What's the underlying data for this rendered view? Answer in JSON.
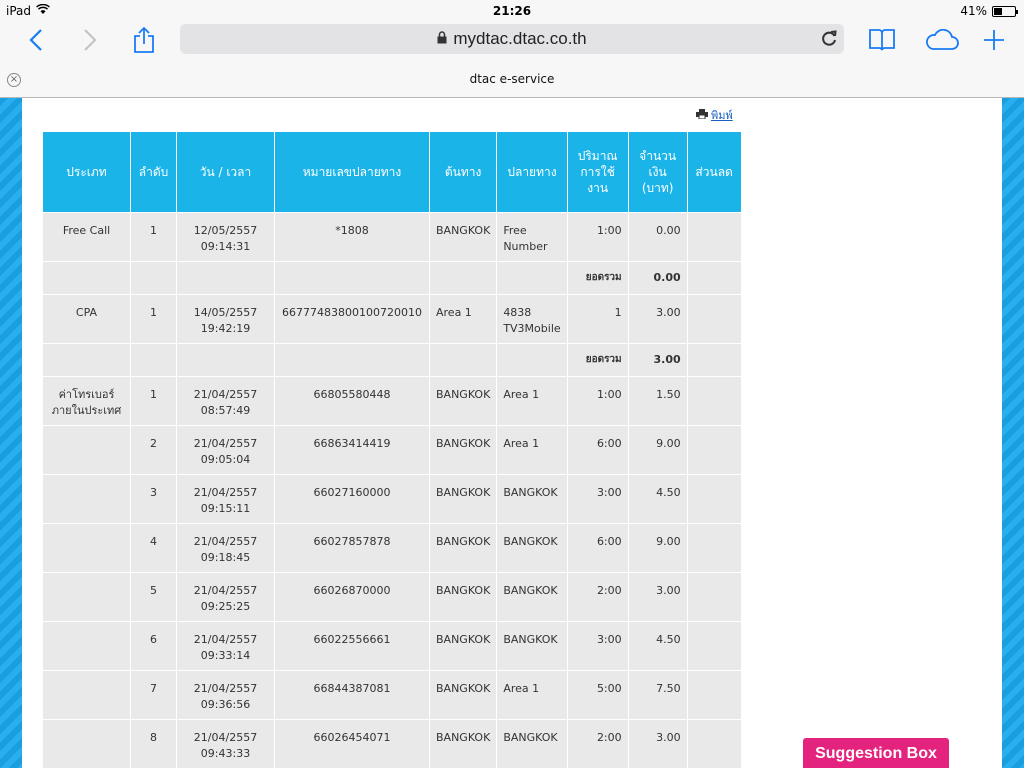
{
  "status": {
    "device": "iPad",
    "time": "21:26",
    "battery": "41%",
    "battery_level": 0.41
  },
  "browser": {
    "url": "mydtac.dtac.co.th",
    "tab_title": "dtac e-service",
    "icons": {
      "back": "chevron-left-icon",
      "forward": "chevron-right-icon",
      "share": "share-icon",
      "bookmarks": "book-icon",
      "cloud": "cloud-icon",
      "new_tab": "plus-icon",
      "reload": "reload-icon",
      "lock": "lock-icon"
    }
  },
  "colors": {
    "header_bg": "#1bb4e8",
    "stripe": "#1a9ee0",
    "cell_bg": "#e9e9e9",
    "suggestion": "#e3237d"
  },
  "page": {
    "print_label": "พิมพ์",
    "suggestion_label": "Suggestion Box"
  },
  "table": {
    "headers": [
      "ประเภท",
      "ลำดับ",
      "วัน / เวลา",
      "หมายเลขปลายทาง",
      "ต้นทาง",
      "ปลายทาง",
      "ปริมาณ การใช้ งาน",
      "จำนวน เงิน (บาท)",
      "ส่วนลด"
    ],
    "rows": [
      {
        "kind": "data",
        "cells": [
          "Free Call",
          "1",
          "12/05/2557 09:14:31",
          "*1808",
          "BANGKOK",
          "Free Number",
          "1:00",
          "0.00",
          ""
        ]
      },
      {
        "kind": "total",
        "label": "ยอดรวม",
        "value": "0.00"
      },
      {
        "kind": "data",
        "cells": [
          "CPA",
          "1",
          "14/05/2557 19:42:19",
          "66777483800100720010",
          "Area 1",
          "4838 TV3Mobile",
          "1",
          "3.00",
          ""
        ]
      },
      {
        "kind": "total",
        "label": "ยอดรวม",
        "value": "3.00"
      },
      {
        "kind": "data",
        "cells": [
          "ค่าโทรเบอร์ ภายในประเทศ",
          "1",
          "21/04/2557 08:57:49",
          "66805580448",
          "BANGKOK",
          "Area 1",
          "1:00",
          "1.50",
          ""
        ]
      },
      {
        "kind": "data",
        "cells": [
          "",
          "2",
          "21/04/2557 09:05:04",
          "66863414419",
          "BANGKOK",
          "Area 1",
          "6:00",
          "9.00",
          ""
        ]
      },
      {
        "kind": "data",
        "cells": [
          "",
          "3",
          "21/04/2557 09:15:11",
          "66027160000",
          "BANGKOK",
          "BANGKOK",
          "3:00",
          "4.50",
          ""
        ]
      },
      {
        "kind": "data",
        "cells": [
          "",
          "4",
          "21/04/2557 09:18:45",
          "66027857878",
          "BANGKOK",
          "BANGKOK",
          "6:00",
          "9.00",
          ""
        ]
      },
      {
        "kind": "data",
        "cells": [
          "",
          "5",
          "21/04/2557 09:25:25",
          "66026870000",
          "BANGKOK",
          "BANGKOK",
          "2:00",
          "3.00",
          ""
        ]
      },
      {
        "kind": "data",
        "cells": [
          "",
          "6",
          "21/04/2557 09:33:14",
          "66022556661",
          "BANGKOK",
          "BANGKOK",
          "3:00",
          "4.50",
          ""
        ]
      },
      {
        "kind": "data",
        "cells": [
          "",
          "7",
          "21/04/2557 09:36:56",
          "66844387081",
          "BANGKOK",
          "Area 1",
          "5:00",
          "7.50",
          ""
        ]
      },
      {
        "kind": "data",
        "cells": [
          "",
          "8",
          "21/04/2557 09:43:33",
          "66026454071",
          "BANGKOK",
          "BANGKOK",
          "2:00",
          "3.00",
          ""
        ]
      }
    ]
  }
}
